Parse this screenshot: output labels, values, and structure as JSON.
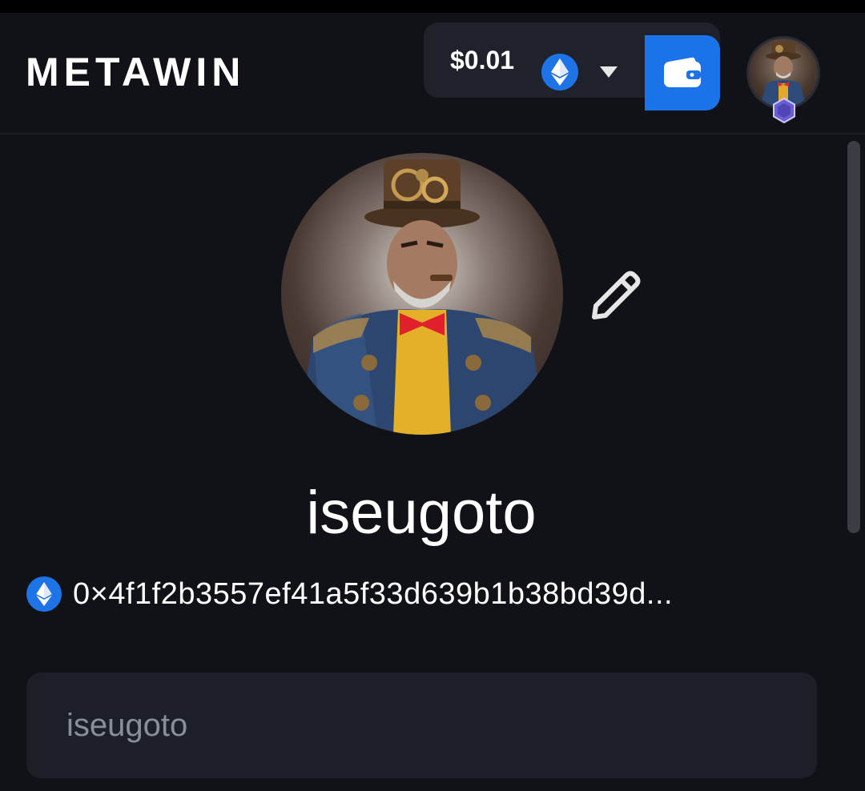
{
  "header": {
    "logo_text": "METAWIN",
    "balance": "$0.01",
    "currency_icon": "ethereum-icon",
    "dropdown_icon": "chevron-down-icon",
    "wallet_icon": "wallet-icon",
    "brand_color": "#1a73e8"
  },
  "profile": {
    "avatar_icon": "profile-avatar-image",
    "edit_icon": "pencil-icon",
    "username": "iseugoto",
    "address": "0×4f1f2b3557ef41a5f33d639b1b38bd39d...",
    "address_currency_icon": "ethereum-icon"
  },
  "form": {
    "username_placeholder": "iseugoto"
  }
}
